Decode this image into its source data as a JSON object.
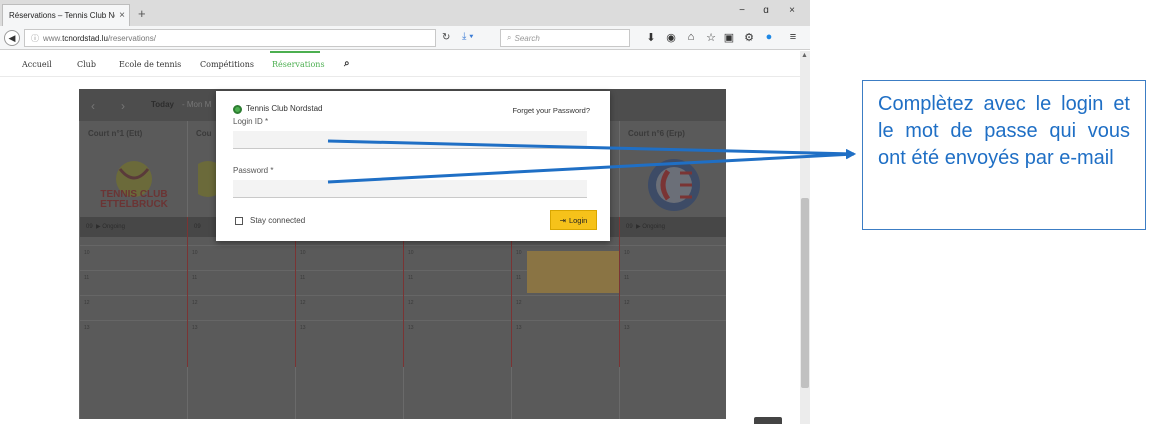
{
  "browser": {
    "tab_title": "Réservations – Tennis Club No...",
    "tab_close": "×",
    "new_tab": "+",
    "window_controls": [
      "−",
      "ɑ",
      "×"
    ],
    "url_prefix": "www.",
    "url_host": "tcnordstad.lu",
    "url_path": "/reservations/",
    "search_placeholder": "Search",
    "toolbar_icons": [
      "download-icon",
      "pocket-icon",
      "home-icon",
      "bookmark-star-icon",
      "reading-list-icon",
      "extension-icon",
      "skype-icon",
      "menu-icon"
    ]
  },
  "site_nav": {
    "items": [
      "Accueil",
      "Club",
      "Ecole de tennis",
      "Compétitions",
      "Réservations"
    ],
    "active": "Réservations",
    "search_icon": "search-icon",
    "accent_color": "#4caf50"
  },
  "calendar": {
    "today_label": "Today",
    "today_rest": "- Mon M",
    "courts": [
      "Court n°1 (Ett)",
      "Cou",
      "",
      "",
      "",
      "Court n°6 (Erp)"
    ],
    "ongoing_label": "Ongoing",
    "slot_times": [
      "10",
      "11",
      "12",
      "13"
    ]
  },
  "login_modal": {
    "club_name": "Tennis Club Nordstad",
    "forgot_password": "Forget your Password?",
    "login_id_label": "Login ID *",
    "password_label": "Password *",
    "stay_connected_label": "Stay connected",
    "login_button": "Login",
    "login_button_color": "#f6c21a"
  },
  "annotation": {
    "text": "Complètez avec le login et le mot de passe qui vous ont été envoyés par e-mail",
    "color": "#1f6fc5"
  }
}
